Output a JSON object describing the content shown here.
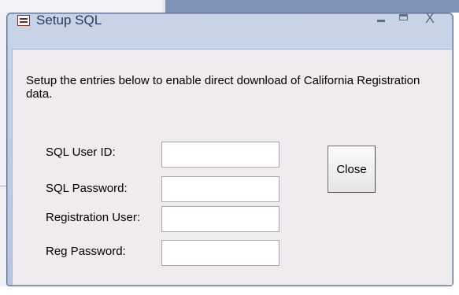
{
  "window": {
    "title": "Setup SQL",
    "icon": "form-icon",
    "controls": {
      "minimize": "minimize-icon",
      "maximize": "maximize-icon",
      "close": "X"
    }
  },
  "instructions": "Setup the entries below to enable direct download of California Registration data.",
  "fields": {
    "sql_user_id": {
      "label": "SQL User ID:",
      "value": ""
    },
    "sql_password": {
      "label": "SQL Password:",
      "value": ""
    },
    "registration_user": {
      "label": "Registration User:",
      "value": ""
    },
    "reg_password": {
      "label": "Reg Password:",
      "value": ""
    }
  },
  "buttons": {
    "close_label": "Close"
  },
  "colors": {
    "titlebar": "#c8d4e6",
    "client_background": "#efebee",
    "background_band": "#7f93b8"
  }
}
